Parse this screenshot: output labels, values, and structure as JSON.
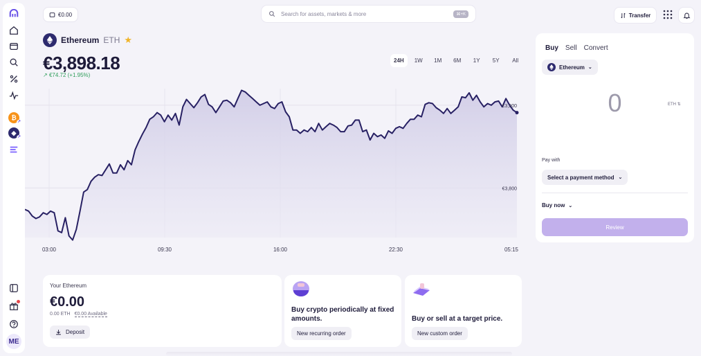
{
  "balance_pill": {
    "value": "€0.00"
  },
  "search": {
    "placeholder": "Search for assets, markets & more",
    "shortcut": "⌘+K"
  },
  "header": {
    "transfer_label": "Transfer"
  },
  "sidebar": {
    "avatar": "ME"
  },
  "asset": {
    "name": "Ethereum",
    "ticker": "ETH",
    "price": "€3,898.18",
    "change": "€74.72 (+1.95%)"
  },
  "range_tabs": [
    "24H",
    "1W",
    "1M",
    "6M",
    "1Y",
    "5Y",
    "All"
  ],
  "chart_data": {
    "type": "area",
    "x_ticks": [
      "03:00",
      "09:30",
      "16:00",
      "22:30",
      "05:15"
    ],
    "y_ticks": [
      {
        "label": "€3,900",
        "value": 3900
      },
      {
        "label": "€3,800",
        "value": 3800
      }
    ],
    "ylim": [
      3740,
      3920
    ],
    "grid": true,
    "values": [
      3774,
      3772,
      3766,
      3763,
      3765,
      3770,
      3768,
      3772,
      3770,
      3748,
      3746,
      3764,
      3742,
      3737,
      3750,
      3772,
      3795,
      3798,
      3808,
      3813,
      3816,
      3815,
      3822,
      3829,
      3818,
      3818,
      3828,
      3822,
      3833,
      3828,
      3846,
      3856,
      3865,
      3873,
      3883,
      3886,
      3891,
      3888,
      3880,
      3888,
      3882,
      3890,
      3876,
      3898,
      3907,
      3902,
      3897,
      3903,
      3910,
      3913,
      3901,
      3898,
      3891,
      3898,
      3905,
      3906,
      3903,
      3898,
      3908,
      3918,
      3916,
      3912,
      3908,
      3904,
      3900,
      3902,
      3904,
      3898,
      3896,
      3902,
      3904,
      3892,
      3886,
      3870,
      3870,
      3866,
      3870,
      3868,
      3873,
      3868,
      3878,
      3870,
      3874,
      3878,
      3876,
      3873,
      3868,
      3868,
      3875,
      3876,
      3882,
      3882,
      3868,
      3870,
      3858,
      3866,
      3862,
      3864,
      3860,
      3869,
      3866,
      3872,
      3874,
      3872,
      3878,
      3883,
      3883,
      3888,
      3886,
      3901,
      3903,
      3902,
      3897,
      3894,
      3890,
      3896,
      3890,
      3894,
      3898,
      3910,
      3909,
      3915,
      3906,
      3912,
      3904,
      3898,
      3902,
      3900,
      3904,
      3905,
      3898,
      3908,
      3900,
      3894,
      3891
    ]
  },
  "holdings": {
    "title": "Your Ethereum",
    "value": "€0.00",
    "eth_amount": "0.00 ETH",
    "available": "€0.00 Available",
    "deposit_label": "Deposit"
  },
  "recurring": {
    "title": "Buy crypto periodically at fixed amounts.",
    "button": "New recurring order"
  },
  "custom": {
    "title": "Buy or sell at a target price.",
    "button": "New custom order"
  },
  "trade": {
    "tabs": [
      "Buy",
      "Sell",
      "Convert"
    ],
    "asset": "Ethereum",
    "amount": "0",
    "amount_unit": "ETH",
    "pay_with_label": "Pay with",
    "pay_method": "Select a payment method",
    "order_type": "Buy now",
    "review_label": "Review"
  },
  "colors": {
    "accent": "#7b61ff",
    "line": "#272063",
    "positive": "#2f9e5b",
    "review": "#c2b0ec"
  }
}
